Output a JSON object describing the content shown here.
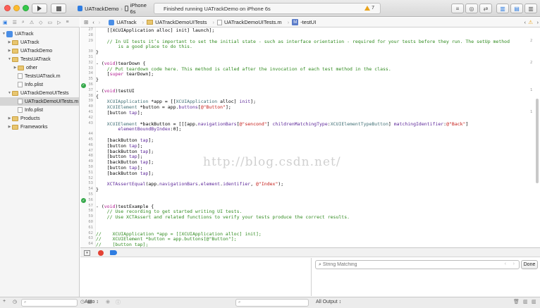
{
  "toolbar": {
    "scheme_name": "UATrackDemo",
    "device": "iPhone 6s",
    "status_text": "Finished running UATrackDemo on iPhone 6s",
    "warning_count": "7"
  },
  "jumpbar": {
    "project": "UATrack",
    "group": "UATrackDemoUITests",
    "file": "UATrackDemoUITests.m",
    "method_icon": "M",
    "method": "-testUI"
  },
  "navigator": {
    "items": [
      {
        "label": "UATrack",
        "kind": "project",
        "indent": 0,
        "open": true,
        "selected": false
      },
      {
        "label": "UATrack",
        "kind": "folder",
        "indent": 1,
        "open": false,
        "selected": false
      },
      {
        "label": "UATrackDemo",
        "kind": "folder",
        "indent": 1,
        "open": false,
        "selected": false
      },
      {
        "label": "TestsUATrack",
        "kind": "folder",
        "indent": 1,
        "open": true,
        "selected": false
      },
      {
        "label": "other",
        "kind": "folder",
        "indent": 2,
        "open": false,
        "selected": false
      },
      {
        "label": "TestsUATrack.m",
        "kind": "file",
        "indent": 2,
        "open": null,
        "selected": false
      },
      {
        "label": "Info.plist",
        "kind": "file",
        "indent": 2,
        "open": null,
        "selected": false
      },
      {
        "label": "UATrackDemoUITests",
        "kind": "folder",
        "indent": 1,
        "open": true,
        "selected": false
      },
      {
        "label": "UATrackDemoUITests.m",
        "kind": "file",
        "indent": 2,
        "open": null,
        "selected": true
      },
      {
        "label": "Info.plist",
        "kind": "file",
        "indent": 2,
        "open": null,
        "selected": false
      },
      {
        "label": "Products",
        "kind": "folder",
        "indent": 1,
        "open": false,
        "selected": false
      },
      {
        "label": "Frameworks",
        "kind": "folder",
        "indent": 1,
        "open": false,
        "selected": false
      }
    ]
  },
  "editor": {
    "watermark": "http://blog.csdn.net/",
    "lines": [
      {
        "n": "27",
        "diamond": false,
        "t": [
          [
            "pl",
            "    [[XCUIApplication alloc] init] launch];"
          ]
        ]
      },
      {
        "n": "28",
        "diamond": false,
        "t": []
      },
      {
        "n": "29",
        "diamond": false,
        "t": [
          [
            "cm",
            "    // In UI tests it’s important to set the initial state - such as interface orientation - required for your tests before they run. The setUp method"
          ]
        ]
      },
      {
        "n": "",
        "diamond": false,
        "t": [
          [
            "cm",
            "        is a good place to do this."
          ]
        ]
      },
      {
        "n": "30",
        "diamond": false,
        "t": [
          [
            "pl",
            "}"
          ]
        ]
      },
      {
        "n": "31",
        "diamond": false,
        "t": []
      },
      {
        "n": "32",
        "diamond": false,
        "t": [
          [
            "pl",
            "- ("
          ],
          [
            "kw",
            "void"
          ],
          [
            "pl",
            ")tearDown {"
          ]
        ]
      },
      {
        "n": "33",
        "diamond": false,
        "t": [
          [
            "cm",
            "    // Put teardown code here. This method is called after the invocation of each test method in the class."
          ]
        ]
      },
      {
        "n": "34",
        "diamond": false,
        "t": [
          [
            "pl",
            "    ["
          ],
          [
            "kw",
            "super"
          ],
          [
            "pl",
            " tearDown];"
          ]
        ]
      },
      {
        "n": "35",
        "diamond": false,
        "t": [
          [
            "pl",
            "}"
          ]
        ]
      },
      {
        "n": "36",
        "diamond": true,
        "t": []
      },
      {
        "n": "37",
        "diamond": false,
        "t": [
          [
            "pl",
            "- ("
          ],
          [
            "kw",
            "void"
          ],
          [
            "pl",
            ")testUI"
          ]
        ]
      },
      {
        "n": "38",
        "diamond": false,
        "t": [
          [
            "pl",
            "{"
          ]
        ]
      },
      {
        "n": "39",
        "diamond": false,
        "t": [
          [
            "pl",
            "    "
          ],
          [
            "cls",
            "XCUIApplication"
          ],
          [
            "pl",
            " *app = [["
          ],
          [
            "cls",
            "XCUIApplication"
          ],
          [
            "pl",
            " alloc] "
          ],
          [
            "pr",
            "init"
          ],
          [
            "pl",
            "];"
          ]
        ]
      },
      {
        "n": "40",
        "diamond": false,
        "t": [
          [
            "pl",
            "    "
          ],
          [
            "cls",
            "XCUIElement"
          ],
          [
            "pl",
            " *button = app."
          ],
          [
            "pr",
            "buttons"
          ],
          [
            "pl",
            "["
          ],
          [
            "st",
            "@\"Button\""
          ],
          [
            "pl",
            "];"
          ]
        ]
      },
      {
        "n": "41",
        "diamond": false,
        "t": [
          [
            "pl",
            "    [button "
          ],
          [
            "pr",
            "tap"
          ],
          [
            "pl",
            "];"
          ]
        ]
      },
      {
        "n": "42",
        "diamond": false,
        "t": []
      },
      {
        "n": "43",
        "diamond": false,
        "t": [
          [
            "pl",
            "    "
          ],
          [
            "cls",
            "XCUIElement"
          ],
          [
            "pl",
            " *backButton = [[[app."
          ],
          [
            "pr",
            "navigationBars"
          ],
          [
            "pl",
            "["
          ],
          [
            "st",
            "@\"sencond\""
          ],
          [
            "pl",
            "] "
          ],
          [
            "pr",
            "childrenMatchingType"
          ],
          [
            "pl",
            ":"
          ],
          [
            "cls",
            "XCUIElementTypeButton"
          ],
          [
            "pl",
            "] "
          ],
          [
            "pr",
            "matchingIdentifier"
          ],
          [
            "pl",
            ":"
          ],
          [
            "st",
            "@\"Back\""
          ],
          [
            "pl",
            "]"
          ]
        ]
      },
      {
        "n": "",
        "diamond": false,
        "t": [
          [
            "pl",
            "        "
          ],
          [
            "pr",
            "elementBoundByIndex"
          ],
          [
            "pl",
            ":0];"
          ]
        ]
      },
      {
        "n": "44",
        "diamond": false,
        "t": []
      },
      {
        "n": "45",
        "diamond": false,
        "t": [
          [
            "pl",
            "    [backButton "
          ],
          [
            "pr",
            "tap"
          ],
          [
            "pl",
            "];"
          ]
        ]
      },
      {
        "n": "46",
        "diamond": false,
        "t": [
          [
            "pl",
            "    [button "
          ],
          [
            "pr",
            "tap"
          ],
          [
            "pl",
            "];"
          ]
        ]
      },
      {
        "n": "47",
        "diamond": false,
        "t": [
          [
            "pl",
            "    [backButton "
          ],
          [
            "pr",
            "tap"
          ],
          [
            "pl",
            "];"
          ]
        ]
      },
      {
        "n": "48",
        "diamond": false,
        "t": [
          [
            "pl",
            "    [button "
          ],
          [
            "pr",
            "tap"
          ],
          [
            "pl",
            "];"
          ]
        ]
      },
      {
        "n": "49",
        "diamond": false,
        "t": [
          [
            "pl",
            "    [backButton "
          ],
          [
            "pr",
            "tap"
          ],
          [
            "pl",
            "];"
          ]
        ]
      },
      {
        "n": "50",
        "diamond": false,
        "t": [
          [
            "pl",
            "    [button "
          ],
          [
            "pr",
            "tap"
          ],
          [
            "pl",
            "];"
          ]
        ]
      },
      {
        "n": "51",
        "diamond": false,
        "t": [
          [
            "pl",
            "    [backButton "
          ],
          [
            "pr",
            "tap"
          ],
          [
            "pl",
            "];"
          ]
        ]
      },
      {
        "n": "52",
        "diamond": false,
        "t": []
      },
      {
        "n": "53",
        "diamond": false,
        "t": [
          [
            "pl",
            "    "
          ],
          [
            "pr",
            "XCTAssertEqual"
          ],
          [
            "pl",
            "(app."
          ],
          [
            "pr",
            "navigationBars"
          ],
          [
            "pl",
            "."
          ],
          [
            "pr",
            "element"
          ],
          [
            "pl",
            "."
          ],
          [
            "pr",
            "identifier"
          ],
          [
            "pl",
            ", "
          ],
          [
            "st",
            "@\"Index\""
          ],
          [
            "pl",
            ");"
          ]
        ]
      },
      {
        "n": "54",
        "diamond": false,
        "t": [
          [
            "pl",
            "}"
          ]
        ]
      },
      {
        "n": "55",
        "diamond": false,
        "t": []
      },
      {
        "n": "56",
        "diamond": true,
        "t": []
      },
      {
        "n": "57",
        "diamond": false,
        "t": [
          [
            "pl",
            "- ("
          ],
          [
            "kw",
            "void"
          ],
          [
            "pl",
            ")testExample {"
          ]
        ]
      },
      {
        "n": "58",
        "diamond": false,
        "t": [
          [
            "cm",
            "    // Use recording to get started writing UI tests."
          ]
        ]
      },
      {
        "n": "59",
        "diamond": false,
        "t": [
          [
            "cm",
            "    // Use XCTAssert and related functions to verify your tests produce the correct results."
          ]
        ]
      },
      {
        "n": "60",
        "diamond": false,
        "t": []
      },
      {
        "n": "61",
        "diamond": false,
        "t": []
      },
      {
        "n": "62",
        "diamond": false,
        "t": [
          [
            "cm",
            "//    XCUIApplication *app = [[XCUIApplication alloc] init];"
          ]
        ]
      },
      {
        "n": "63",
        "diamond": false,
        "t": [
          [
            "cm",
            "//    XCUIElement *button = app.buttons[@\"Button\"];"
          ]
        ]
      },
      {
        "n": "64",
        "diamond": false,
        "t": [
          [
            "cm",
            "//    [button tap];"
          ]
        ]
      }
    ],
    "right_numbers": [
      {
        "row": 2,
        "v": "2"
      },
      {
        "row": 6,
        "v": "2"
      },
      {
        "row": 11,
        "v": "1"
      },
      {
        "row": 15,
        "v": "1"
      }
    ]
  },
  "debug": {
    "search_placeholder": "String Matching",
    "done_label": "Done",
    "auto_label": "Auto ↕",
    "all_output_label": "All Output ↕"
  },
  "colors": {
    "selection": "#d5d5d5",
    "accent": "#2f7de1",
    "comment": "#2f8a1e",
    "keyword": "#b0198f",
    "string": "#c41a16"
  }
}
